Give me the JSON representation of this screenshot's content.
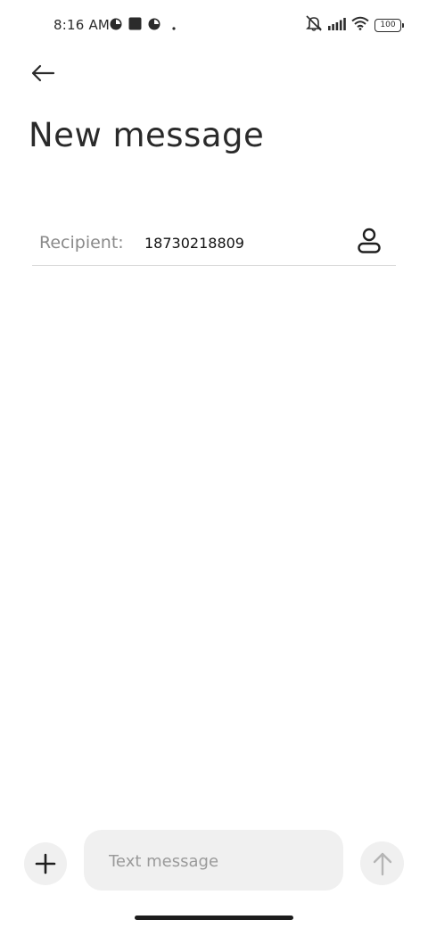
{
  "status_bar": {
    "time": "8:16 AM",
    "notification_icons": [
      "app-icon",
      "stop-icon",
      "app-icon",
      "dot-icon"
    ],
    "right_icons": [
      "mute-icon",
      "signal-icon",
      "wifi-icon"
    ],
    "battery_level": "100"
  },
  "header": {
    "back_icon": "arrow-left-icon",
    "title": "New message"
  },
  "recipient": {
    "label": "Recipient:",
    "value": "18730218809",
    "contact_icon": "person-icon"
  },
  "composer": {
    "attach_icon": "plus-icon",
    "placeholder": "Text message",
    "value": "",
    "send_icon": "arrow-up-icon"
  },
  "colors": {
    "background": "#ffffff",
    "text": "#1f1f1f",
    "label": "#8a8a8a",
    "divider": "#d9d9d9",
    "control_bg": "#f0f0f0",
    "send_disabled": "#b5b5b5"
  }
}
